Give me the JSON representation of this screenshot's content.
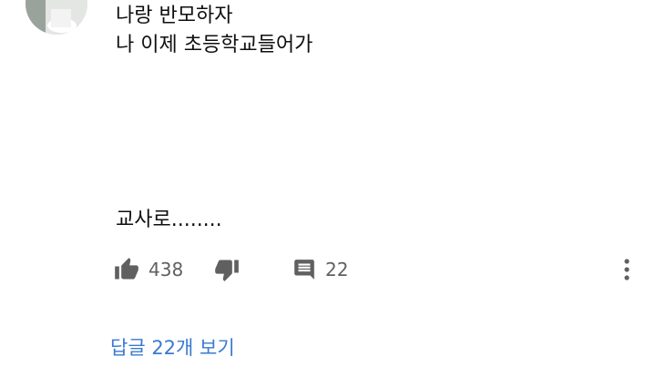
{
  "comment": {
    "body": "나랑 반모하자\n나 이제 초등학교들어가\n\n\n\n\n\n교사로........",
    "like_count": "438",
    "reply_count": "22"
  },
  "replies": {
    "view_label": "답글 22개 보기"
  },
  "colors": {
    "text": "#0f0f0f",
    "secondary": "#606060",
    "link": "#3a79d1"
  },
  "icons": {
    "like": "thumb-up-icon",
    "dislike": "thumb-down-icon",
    "reply": "comment-icon",
    "more": "more-vertical-icon"
  }
}
